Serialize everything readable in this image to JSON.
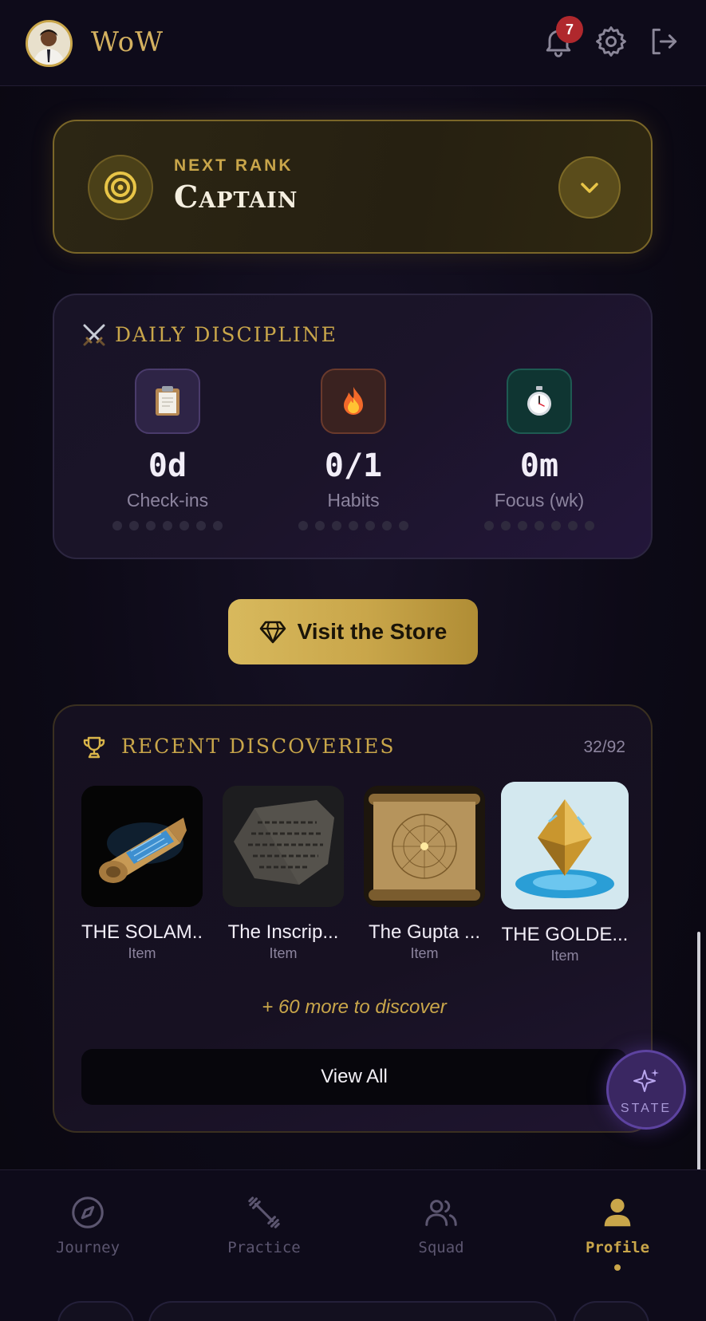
{
  "header": {
    "brand": "WoW",
    "notification_count": "7",
    "icons": [
      "bell-icon",
      "gear-icon",
      "logout-icon"
    ]
  },
  "rank": {
    "eyebrow": "NEXT RANK",
    "name": "Captain"
  },
  "daily": {
    "title": "DAILY DISCIPLINE",
    "stats": [
      {
        "value": "0d",
        "label": "Check-ins",
        "icon": "clipboard-icon",
        "dots": 7,
        "color": "#2e2446"
      },
      {
        "value": "0/1",
        "label": "Habits",
        "icon": "fire-icon",
        "dots": 7,
        "color": "#3a2220"
      },
      {
        "value": "0m",
        "label": "Focus (wk)",
        "icon": "stopwatch-icon",
        "dots": 7,
        "color": "#0f3532"
      }
    ]
  },
  "store": {
    "label": "Visit the Store"
  },
  "discoveries": {
    "title": "RECENT DISCOVERIES",
    "count": "32/92",
    "items": [
      {
        "name": "THE SOLAM...",
        "type": "Item"
      },
      {
        "name": "The Inscrip...",
        "type": "Item"
      },
      {
        "name": "The Gupta ...",
        "type": "Item"
      },
      {
        "name": "THE GOLDE...",
        "type": "Item"
      }
    ],
    "more": "+ 60 more to discover",
    "view_all": "View All"
  },
  "fab": {
    "label": "STATE"
  },
  "nav": [
    {
      "label": "Journey",
      "icon": "compass-icon",
      "active": false
    },
    {
      "label": "Practice",
      "icon": "dumbbell-icon",
      "active": false
    },
    {
      "label": "Squad",
      "icon": "users-icon",
      "active": false
    },
    {
      "label": "Profile",
      "icon": "user-icon",
      "active": true
    }
  ],
  "colors": {
    "gold": "#c9a64a",
    "background": "#0c0a16",
    "badge": "#b0282d",
    "accent_purple": "#5d43a0"
  }
}
